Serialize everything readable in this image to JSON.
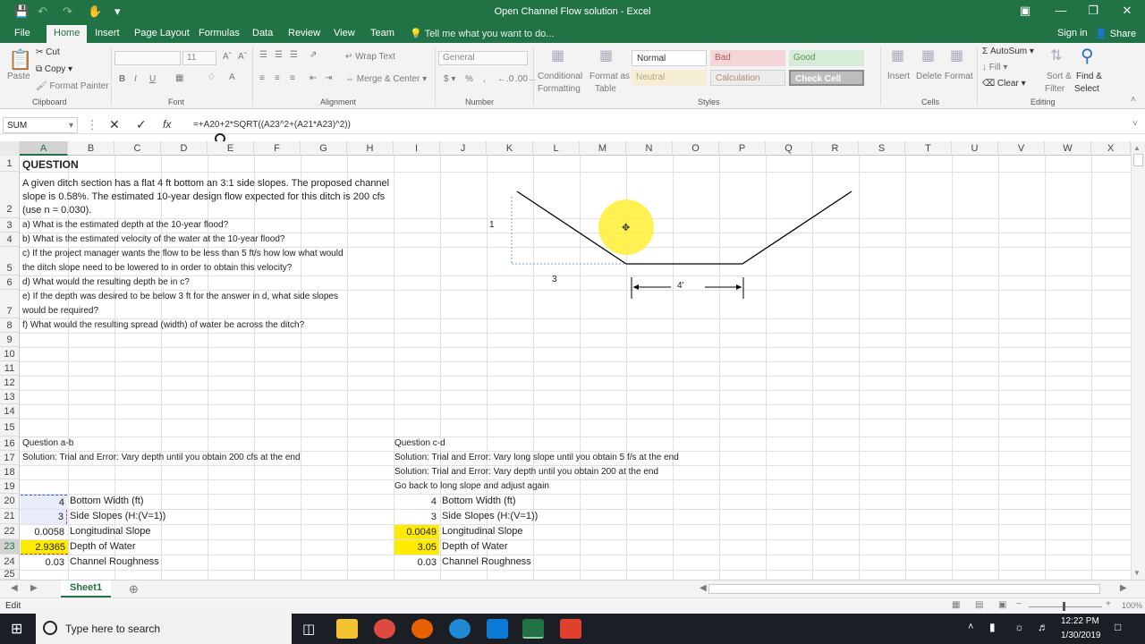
{
  "window": {
    "title": "Open Channel Flow solution - Excel"
  },
  "tabs": [
    "File",
    "Home",
    "Insert",
    "Page Layout",
    "Formulas",
    "Data",
    "Review",
    "View",
    "Team"
  ],
  "active_tab": "Home",
  "tellme": "Tell me what you want to do...",
  "account": {
    "signin": "Sign in",
    "share": "Share"
  },
  "ribbon": {
    "clipboard": {
      "label": "Clipboard",
      "paste": "Paste",
      "cut": "Cut",
      "copy": "Copy",
      "format_painter": "Format Painter"
    },
    "font": {
      "label": "Font",
      "size": "11"
    },
    "alignment": {
      "label": "Alignment",
      "wrap": "Wrap Text",
      "merge": "Merge & Center"
    },
    "number": {
      "label": "Number",
      "format": "General"
    },
    "styles": {
      "label": "Styles",
      "cond": "Conditional",
      "cond2": "Formatting",
      "fmt_table": "Format as",
      "fmt_table2": "Table",
      "normal": "Normal",
      "bad": "Bad",
      "good": "Good",
      "neutral": "Neutral",
      "calculation": "Calculation",
      "check": "Check Cell"
    },
    "cells": {
      "label": "Cells",
      "insert": "Insert",
      "delete": "Delete",
      "format": "Format"
    },
    "editing": {
      "label": "Editing",
      "autosum": "AutoSum",
      "fill": "Fill",
      "clear": "Clear",
      "sort": "Sort &",
      "sort2": "Filter",
      "find": "Find &",
      "find2": "Select"
    }
  },
  "formula_bar": {
    "name": "SUM",
    "formula": "=+A20+2*SQRT((A23^2+(A21*A23)^2))"
  },
  "columns": [
    "A",
    "B",
    "C",
    "D",
    "E",
    "F",
    "G",
    "H",
    "I",
    "J",
    "K",
    "L",
    "M",
    "N",
    "O",
    "P",
    "Q",
    "R",
    "S",
    "T",
    "U",
    "V",
    "W",
    "X"
  ],
  "rows": [
    "1",
    "2",
    "3",
    "4",
    "5",
    "6",
    "7",
    "8",
    "9",
    "10",
    "11",
    "12",
    "13",
    "14",
    "15",
    "16",
    "17",
    "18",
    "19",
    "20",
    "21",
    "22",
    "23",
    "24",
    "25"
  ],
  "cells": {
    "a1": "QUESTION",
    "a2_l1": "A given ditch section has a flat 4 ft bottom an 3:1 side slopes. The proposed channel",
    "a2_l2": "slope is 0.58%.  The estimated 10-year design flow expected for this ditch is 200 cfs",
    "a2_l3": "(use n = 0.030).",
    "a3": "a) What is the estimated depth at the 10-year flood?",
    "a4": "b) What is the estimated velocity of the water at the 10-year flood?",
    "a5_l1": "c) If the project manager wants the flow to be less than 5 ft/s how low what would",
    "a5_l2": "the ditch slope need to be lowered to in order to obtain this velocity?",
    "a6": "d) What would the resulting depth be in c?",
    "a7_l1": "e) If the depth was desired to be below 3 ft for the answer in d, what side slopes",
    "a7_l2": "would be required?",
    "a8": "f) What would the resulting spread (width) of water be across the ditch?",
    "a16": "Question a-b",
    "a17": "Solution: Trial and Error: Vary depth until you obtain 200 cfs at the end",
    "a20": "4",
    "b20": "Bottom Width (ft)",
    "a21": "3",
    "b21": "Side Slopes (H:(V=1))",
    "a22": "0.0058",
    "b22": "Longitudinal Slope",
    "a23": "2.9365",
    "b23": "Depth of Water",
    "a24": "0.03",
    "b24": "Channel Roughness",
    "i16": "Question c-d",
    "i17": "Solution: Trial and Error: Vary long slope until you obtain 5 f/s at the end",
    "i18": "Solution: Trial and Error: Vary depth until you obtain 200 at the end",
    "i19": "Go back to long slope and adjust again",
    "i20": "4",
    "j20": "Bottom Width (ft)",
    "i21": "3",
    "j21": "Side Slopes (H:(V=1))",
    "i22": "0.0049",
    "j22": "Longitudinal Slope",
    "i23": "3.05",
    "j23": "Depth of Water",
    "i24": "0.03",
    "j24": "Channel Roughness"
  },
  "diagram": {
    "vert_label": "1",
    "horiz_label": "3",
    "bottom_label": "4'"
  },
  "sheet_tab": "Sheet1",
  "status": {
    "mode": "Edit",
    "zoom": "100%"
  },
  "taskbar": {
    "search": "Type here to search",
    "time": "12:22 PM",
    "date": "1/30/2019"
  },
  "colors": {
    "excel_green": "#217346",
    "highlight": "#ffeb00"
  }
}
